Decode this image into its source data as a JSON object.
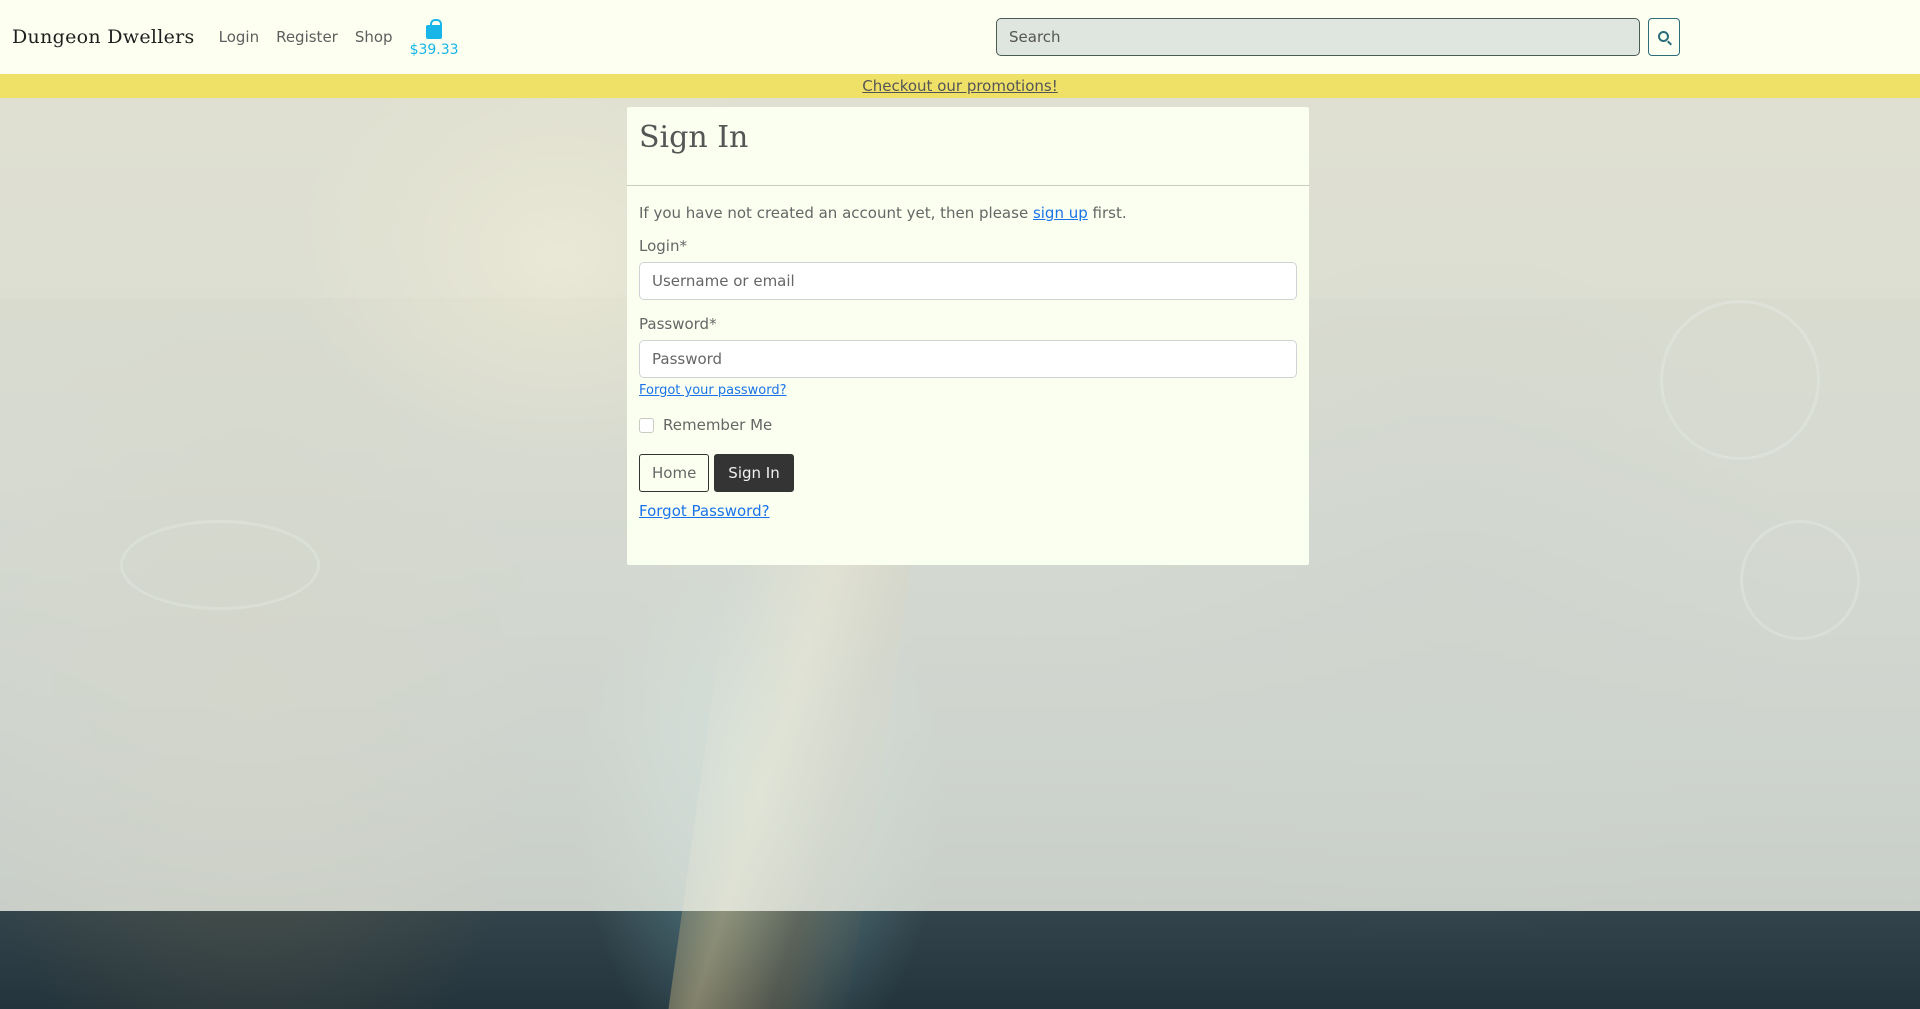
{
  "navbar": {
    "brand": "Dungeon Dwellers",
    "links": [
      "Login",
      "Register",
      "Shop"
    ],
    "cart_total": "$39.33",
    "cart_icon": "shopping-bag-icon",
    "search": {
      "placeholder": "Search",
      "button_icon": "search-icon"
    }
  },
  "promo": {
    "text": "Checkout our promotions!",
    "color": "#efe168"
  },
  "signin": {
    "title": "Sign In",
    "intro_before": "If you have not created an account yet, then please ",
    "intro_link": "sign up",
    "intro_after": " first.",
    "login_label": "Login*",
    "login_placeholder": "Username or email",
    "password_label": "Password*",
    "password_placeholder": "Password",
    "forgot_small": "Forgot your password?",
    "remember_label": "Remember Me",
    "home_button": "Home",
    "signin_button": "Sign In",
    "forgot_bottom": "Forgot Password?"
  },
  "colors": {
    "navbar_bg": "#fdfff1",
    "card_bg": "#fbfff0",
    "link": "#1a73e8",
    "cart": "#18b5e8",
    "dark_button": "#343434"
  }
}
